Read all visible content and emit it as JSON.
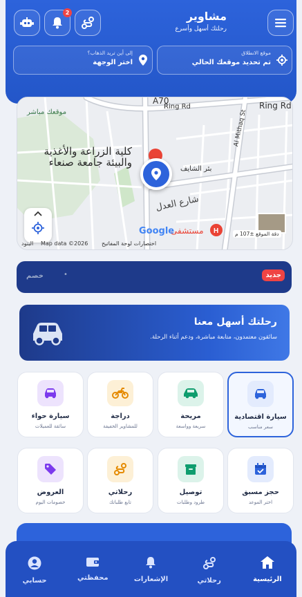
{
  "header": {
    "title": "مشاوير",
    "subtitle": "رحلتك أسهل وأسرع",
    "notification_count": "2",
    "pickup": {
      "label": "موقع الانطلاق",
      "value": "تم تحديد موقعك الحالي"
    },
    "destination": {
      "label": "إلى أين تريد الذهاب؟",
      "value": "اختر الوجهة"
    }
  },
  "map": {
    "labels": {
      "ring_rd_1": "Ring Rd",
      "ring_rd_2": "Ring Rd",
      "a70": "A70",
      "al_mithaq": "Al Mithaq St",
      "your_location": "موقعك مباشر",
      "university": "كلية الزراعة والأغذية والبيئة جامعة صنعاء",
      "bir_shayef": "بئر الشايف",
      "street": "شارع العدل",
      "hospital": "مستشفى",
      "accuracy": "دقة الموقع ±107 م",
      "map_data": "Map data ©2026",
      "shortcuts": "اختصارات لوحة المفاتيح",
      "terms": "البنود",
      "google": "Google"
    }
  },
  "promo": {
    "new_tag": "جديد",
    "text": "خصم"
  },
  "hero": {
    "title": "رحلتك أسهل معنا",
    "subtitle": "سائقون معتمدون، متابعة مباشرة، ودعم أثناء الرحلة."
  },
  "services": [
    {
      "title": "سيارة اقتصادية",
      "subtitle": "سعر مناسب",
      "icon": "car-icon",
      "color": "#2d63db"
    },
    {
      "title": "مريحة",
      "subtitle": "سريعة وواسعة",
      "icon": "comfort-car-icon",
      "color": "#0f9d6e"
    },
    {
      "title": "دراجة",
      "subtitle": "للمشاوير الخفيفة",
      "icon": "motorcycle-icon",
      "color": "#e58a00"
    },
    {
      "title": "سيارة حواء",
      "subtitle": "سائقة للعميلات",
      "icon": "women-car-icon",
      "color": "#7c3aed"
    },
    {
      "title": "حجز مسبق",
      "subtitle": "اختر الموعد",
      "icon": "calendar-icon",
      "color": "#2d63db"
    },
    {
      "title": "توصيل",
      "subtitle": "طرود وطلبات",
      "icon": "box-icon",
      "color": "#0f9d6e"
    },
    {
      "title": "رحلاتي",
      "subtitle": "تابع طلباتك",
      "icon": "route-icon",
      "color": "#e58a00"
    },
    {
      "title": "العروض",
      "subtitle": "خصومات اليوم",
      "icon": "tag-icon",
      "color": "#7c3aed"
    }
  ],
  "nav": [
    {
      "label": "الرئيسية",
      "icon": "home-icon",
      "active": true
    },
    {
      "label": "رحلاتي",
      "icon": "route-icon"
    },
    {
      "label": "الإشعارات",
      "icon": "bell-icon"
    },
    {
      "label": "محفظتي",
      "icon": "wallet-icon"
    },
    {
      "label": "حسابي",
      "icon": "user-icon"
    }
  ]
}
